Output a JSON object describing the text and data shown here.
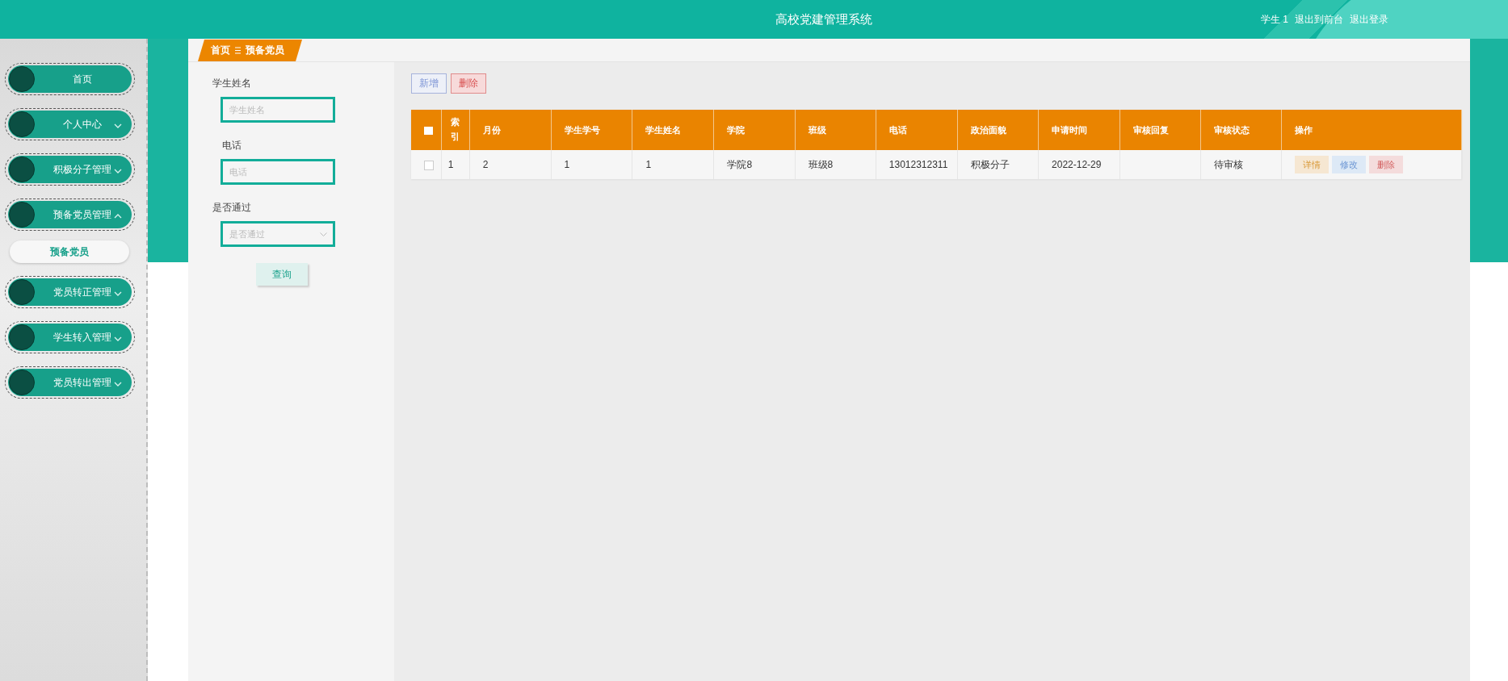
{
  "header": {
    "title": "高校党建管理系统",
    "user": "学生 1",
    "links": [
      "退出到前台",
      "退出登录"
    ]
  },
  "sidebar": {
    "items": [
      {
        "label": "首页",
        "kind": "link"
      },
      {
        "label": "个人中心",
        "kind": "menu",
        "expanded": false
      },
      {
        "label": "积极分子管理",
        "kind": "menu",
        "expanded": false
      },
      {
        "label": "预备党员管理",
        "kind": "menu",
        "expanded": true,
        "children": [
          {
            "label": "预备党员",
            "selected": true
          }
        ]
      },
      {
        "label": "党员转正管理",
        "kind": "menu",
        "expanded": false
      },
      {
        "label": "学生转入管理",
        "kind": "menu",
        "expanded": false
      },
      {
        "label": "党员转出管理",
        "kind": "menu",
        "expanded": false
      }
    ]
  },
  "breadcrumb": [
    "首页",
    "预备党员"
  ],
  "filters": [
    {
      "label": "学生姓名",
      "placeholder": "学生姓名",
      "kind": "input"
    },
    {
      "label": "电话",
      "placeholder": "电话",
      "kind": "input"
    },
    {
      "label": "是否通过",
      "placeholder": "是否通过",
      "kind": "select"
    }
  ],
  "search_button": "查询",
  "toolbar": [
    {
      "label": "新增",
      "kind": "add"
    },
    {
      "label": "删除",
      "kind": "delete"
    }
  ],
  "table": {
    "all_checked": false,
    "columns": [
      "索引",
      "月份",
      "学生学号",
      "学生姓名",
      "学院",
      "班级",
      "电话",
      "政治面貌",
      "申请时间",
      "审核回复",
      "审核状态",
      "操作"
    ],
    "rows": [
      {
        "checked": false,
        "cells": [
          "1",
          "2",
          "1",
          "1",
          "学院8",
          "班级8",
          "13012312311",
          "积极分子",
          "2022-12-29",
          null,
          "待审核"
        ],
        "actions": [
          {
            "label": "详情",
            "kind": "detail"
          },
          {
            "label": "修改",
            "kind": "edit"
          },
          {
            "label": "删除",
            "kind": "delete"
          }
        ]
      }
    ]
  }
}
